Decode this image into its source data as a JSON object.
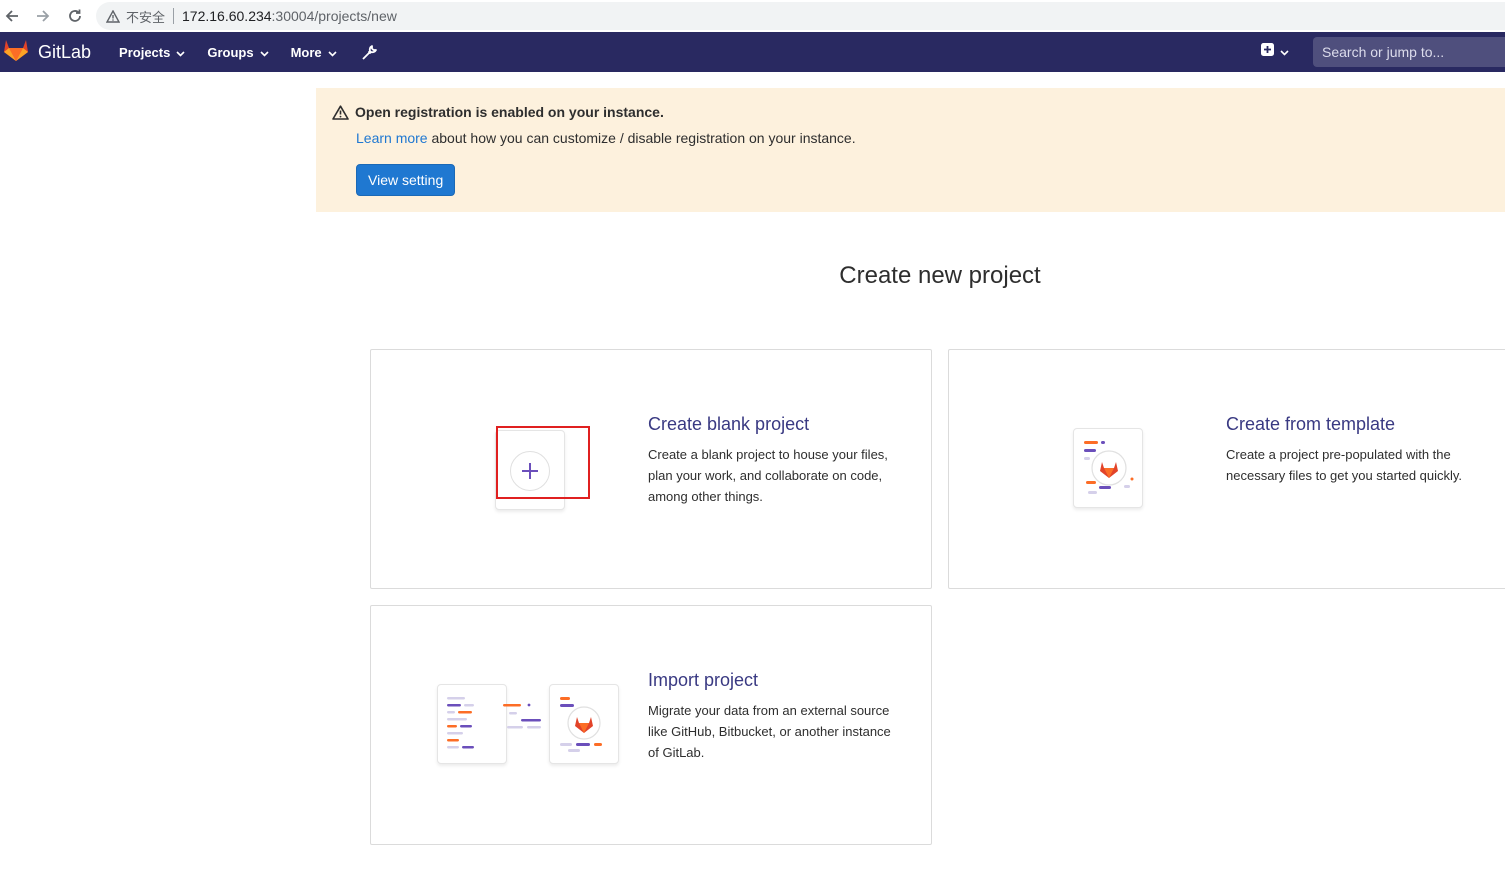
{
  "browser": {
    "security_label": "不安全",
    "url_host": "172.16.60.234",
    "url_path": ":30004/projects/new"
  },
  "header": {
    "brand": "GitLab",
    "menu": [
      {
        "label": "Projects"
      },
      {
        "label": "Groups"
      },
      {
        "label": "More"
      }
    ],
    "search_placeholder": "Search or jump to..."
  },
  "alert": {
    "title": "Open registration is enabled on your instance.",
    "link_text": "Learn more",
    "body_text": " about how you can customize / disable registration on your instance.",
    "button_label": "View setting"
  },
  "page": {
    "title": "Create new project"
  },
  "cards": {
    "blank": {
      "title": "Create blank project",
      "description": "Create a blank project to house your files, plan your work, and collaborate on code, among other things."
    },
    "template": {
      "title": "Create from template",
      "description": "Create a project pre-populated with the necessary files to get you started quickly."
    },
    "import": {
      "title": "Import project",
      "description": "Migrate your data from an external source like GitHub, Bitbucket, or another instance of GitLab."
    }
  },
  "colors": {
    "header_bg": "#292961",
    "alert_bg": "#fdf1dd",
    "primary": "#1f78d1",
    "card_title": "#393982",
    "highlight": "#e02020"
  }
}
